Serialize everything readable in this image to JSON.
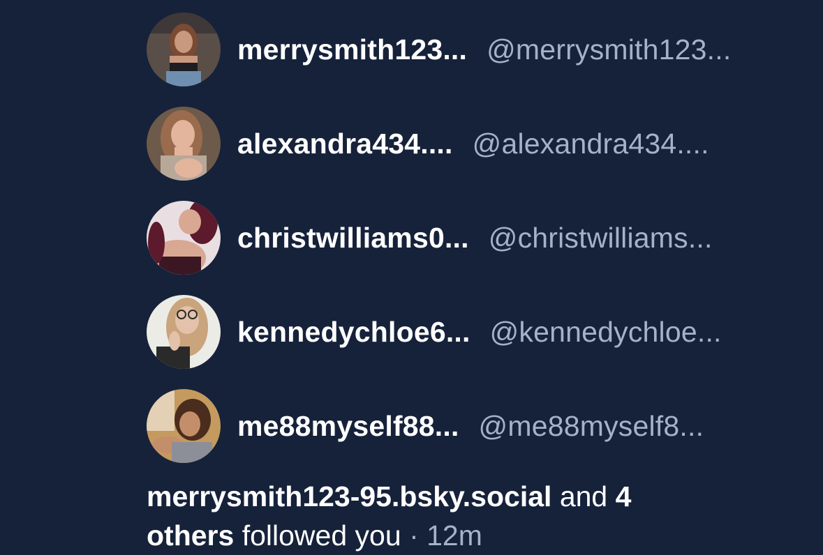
{
  "followers": [
    {
      "name": "merrysmith123...",
      "handle": "@merrysmith123...",
      "avatar_colors": {
        "bg": "#5a4e48",
        "skin": "#c8987f",
        "hair": "#7b4a33",
        "top": "#1d1d22"
      }
    },
    {
      "name": "alexandra434....",
      "handle": "@alexandra434....",
      "avatar_colors": {
        "bg": "#6e5a4a",
        "skin": "#e3b59c",
        "hair": "#9a6c4d",
        "top": "#b8a89a"
      }
    },
    {
      "name": "christwilliams0...",
      "handle": "@christwilliams...",
      "avatar_colors": {
        "bg": "#e9dfe3",
        "skin": "#d9a893",
        "hair": "#5c1a2c",
        "top": "#3b1723"
      }
    },
    {
      "name": "kennedychloe6...",
      "handle": "@kennedychloe...",
      "avatar_colors": {
        "bg": "#ecece7",
        "skin": "#e4c1aa",
        "hair": "#c9a47c",
        "top": "#2a2a2a"
      }
    },
    {
      "name": "me88myself88...",
      "handle": "@me88myself8...",
      "avatar_colors": {
        "bg": "#c59a5e",
        "skin": "#c58e6a",
        "hair": "#4a2d1c",
        "top": "#8c8f98"
      }
    }
  ],
  "summary": {
    "lead": "merrysmith123-95.bsky.social",
    "connector": "and",
    "count": "4",
    "others": "others",
    "action": "followed you",
    "separator": "·",
    "time": "12m"
  },
  "colors": {
    "background": "#16223a",
    "primary_text": "#ffffff",
    "secondary_text": "#a4b3c7"
  }
}
